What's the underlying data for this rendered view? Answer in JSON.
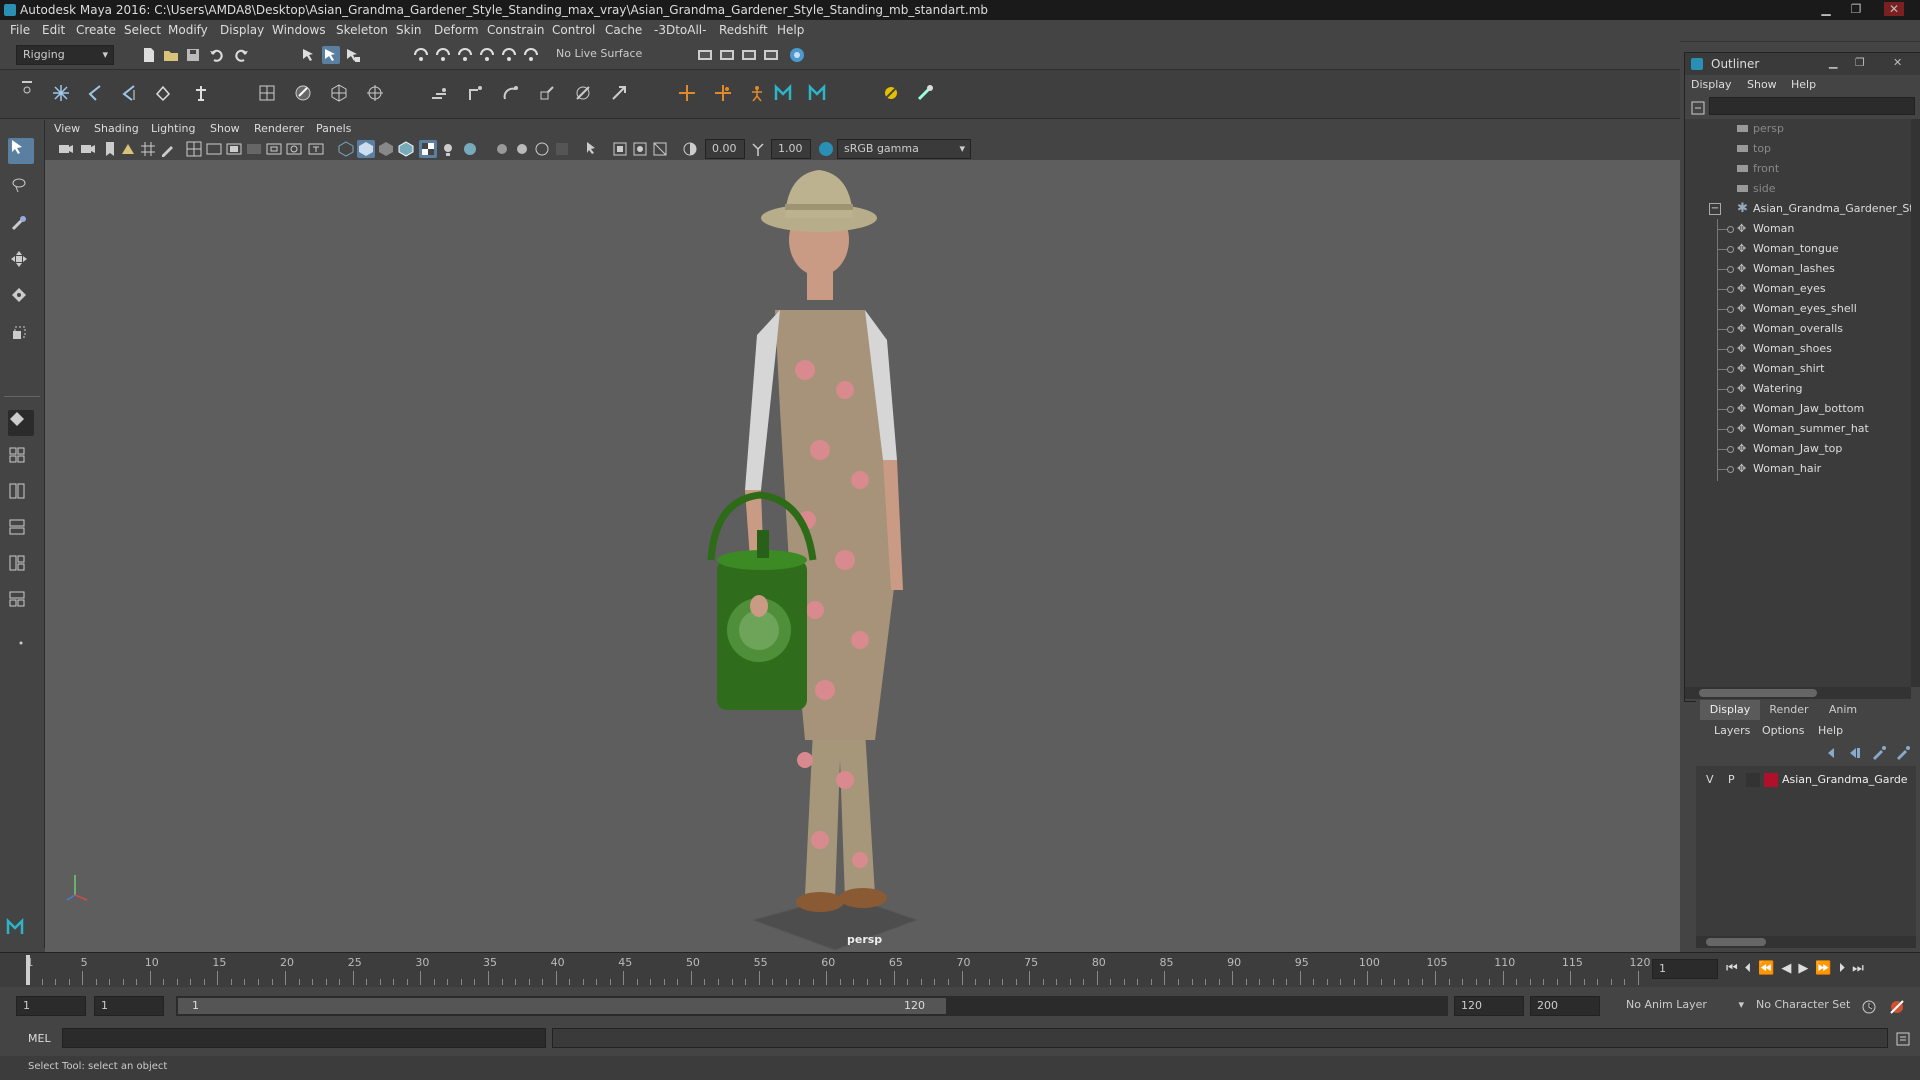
{
  "window": {
    "title": "Autodesk Maya 2016: C:\\Users\\AMDA8\\Desktop\\Asian_Grandma_Gardener_Style_Standing_max_vray\\Asian_Grandma_Gardener_Style_Standing_mb_standart.mb",
    "minimize": "▁",
    "maximize": "❐",
    "close": "✕"
  },
  "menus": [
    "File",
    "Edit",
    "Create",
    "Select",
    "Modify",
    "Display",
    "Windows",
    "Skeleton",
    "Skin",
    "Deform",
    "Constrain",
    "Control",
    "Cache",
    "-3DtoAll-",
    "Redshift",
    "Help"
  ],
  "statusline": {
    "mode": "Rigging",
    "live_surface": "No Live Surface"
  },
  "panel": {
    "menus": [
      "View",
      "Shading",
      "Lighting",
      "Show",
      "Renderer",
      "Panels"
    ],
    "exposure": "0.00",
    "gamma": "1.00",
    "color_space": "sRGB gamma",
    "camera_label": "persp"
  },
  "outliner": {
    "title": "Outliner",
    "menus": [
      "Display",
      "Show",
      "Help"
    ],
    "cameras": [
      "persp",
      "top",
      "front",
      "side"
    ],
    "group": "Asian_Grandma_Gardener_St",
    "children": [
      "Woman",
      "Woman_tongue",
      "Woman_lashes",
      "Woman_eyes",
      "Woman_eyes_shell",
      "Woman_overalls",
      "Woman_shoes",
      "Woman_shirt",
      "Watering",
      "Woman_Jaw_bottom",
      "Woman_summer_hat",
      "Woman_Jaw_top",
      "Woman_hair"
    ]
  },
  "layers": {
    "tabs": [
      "Display",
      "Render",
      "Anim"
    ],
    "menus": [
      "Layers",
      "Options",
      "Help"
    ],
    "row": {
      "v": "V",
      "p": "P",
      "name": "Asian_Grandma_Garde",
      "color": "#b0102a"
    }
  },
  "timeline": {
    "labels": [
      "1",
      "5",
      "10",
      "15",
      "20",
      "25",
      "30",
      "35",
      "40",
      "45",
      "50",
      "55",
      "60",
      "65",
      "70",
      "75",
      "80",
      "85",
      "90",
      "95",
      "100",
      "105",
      "110",
      "115",
      "120"
    ],
    "current_frame": "1"
  },
  "range": {
    "start": "1",
    "playback_start": "1",
    "slider_start": "1",
    "slider_end": "120",
    "playback_end": "120",
    "end": "200",
    "anim_layer": "No Anim Layer",
    "character_set": "No Character Set"
  },
  "command": {
    "label": "MEL"
  },
  "help": {
    "text": "Select Tool: select an object"
  },
  "colors": {
    "accent": "#5aa0d0",
    "layer_color": "#b0102a"
  }
}
